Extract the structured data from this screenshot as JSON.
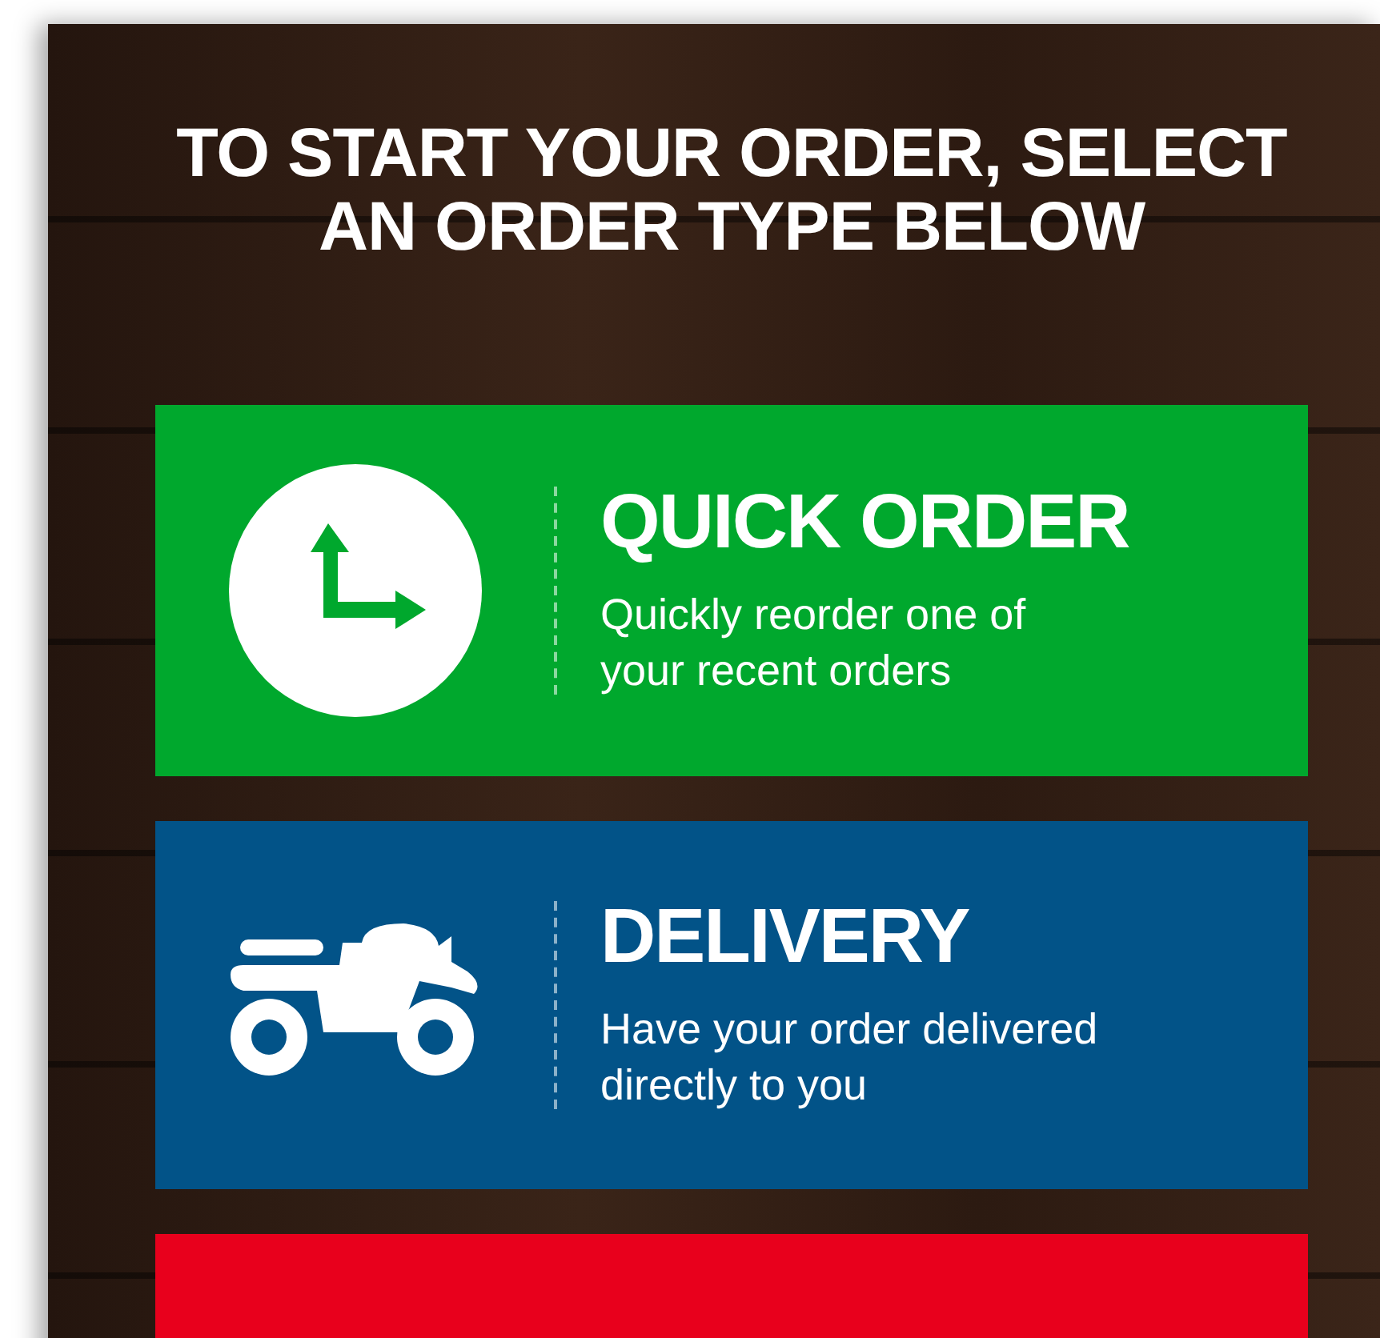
{
  "heading": [
    "TO START YOUR ORDER, SELECT",
    "AN ORDER TYPE BELOW"
  ],
  "options": [
    {
      "kind": "clock",
      "color": "#00a82d",
      "title": "QUICK ORDER",
      "description": [
        "Quickly reorder one of",
        "your recent orders"
      ]
    },
    {
      "kind": "scooter",
      "color": "#025388",
      "title": "DELIVERY",
      "description": [
        "Have your order delivered",
        "directly to you"
      ]
    },
    {
      "kind": "partial",
      "color": "#e8001c"
    }
  ]
}
